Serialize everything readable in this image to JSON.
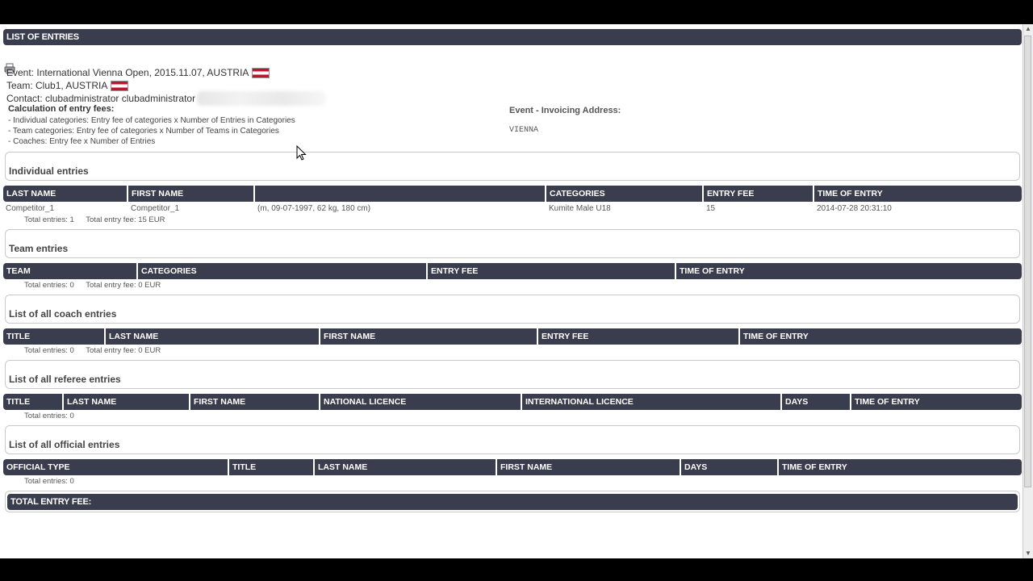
{
  "header": {
    "title": "LIST OF ENTRIES"
  },
  "info": {
    "event": "Event: International Vienna Open, 2015.11.07, AUSTRIA",
    "team": "Team: Club1, AUSTRIA",
    "contact": "Contact: clubadministrator clubadministrator",
    "calc_title": "Calculation of entry fees:",
    "calc_lines": [
      "- Individual categories: Entry fee of categories x Number of Entries in Categories",
      "- Team categories: Entry fee of categories x Number of Teams in Categories",
      "- Coaches: Entry fee x Number of Entries"
    ],
    "invoice_label": "Event - Invoicing Address:",
    "invoice_city": "VIENNA"
  },
  "individual": {
    "title": "Individual entries",
    "columns": [
      "LAST NAME",
      "FIRST NAME",
      "",
      "CATEGORIES",
      "ENTRY FEE",
      "TIME OF ENTRY"
    ],
    "rows": [
      [
        "Competitor_1",
        "Competitor_1",
        "(m, 09-07-1997, 62 kg, 180 cm)",
        "Kumite Male U18",
        "15",
        "2014-07-28 20:31:10"
      ]
    ],
    "total_entries": "Total entries: 1",
    "total_fee": "Total entry fee: 15 EUR"
  },
  "team": {
    "title": "Team entries",
    "columns": [
      "TEAM",
      "CATEGORIES",
      "ENTRY FEE",
      "TIME OF ENTRY"
    ],
    "total_entries": "Total entries: 0",
    "total_fee": "Total entry fee: 0 EUR"
  },
  "coach": {
    "title": "List of all coach entries",
    "columns": [
      "TITLE",
      "LAST NAME",
      "FIRST NAME",
      "ENTRY FEE",
      "TIME OF ENTRY"
    ],
    "total_entries": "Total entries: 0",
    "total_fee": "Total entry fee: 0 EUR"
  },
  "referee": {
    "title": "List of all referee entries",
    "columns": [
      "TITLE",
      "LAST NAME",
      "FIRST NAME",
      "NATIONAL LICENCE",
      "INTERNATIONAL LICENCE",
      "DAYS",
      "TIME OF ENTRY"
    ],
    "total_entries": "Total entries: 0"
  },
  "official": {
    "title": "List of all official entries",
    "columns": [
      "OFFICIAL TYPE",
      "TITLE",
      "LAST NAME",
      "FIRST NAME",
      "DAYS",
      "TIME OF ENTRY"
    ],
    "total_entries": "Total entries: 0"
  },
  "footer": {
    "total_fee_label": "TOTAL ENTRY FEE:"
  },
  "icons": {
    "print": "printer-icon",
    "flag": "austria-flag-icon"
  },
  "colors": {
    "bar": "#3a3d4d",
    "text": "#333333"
  }
}
